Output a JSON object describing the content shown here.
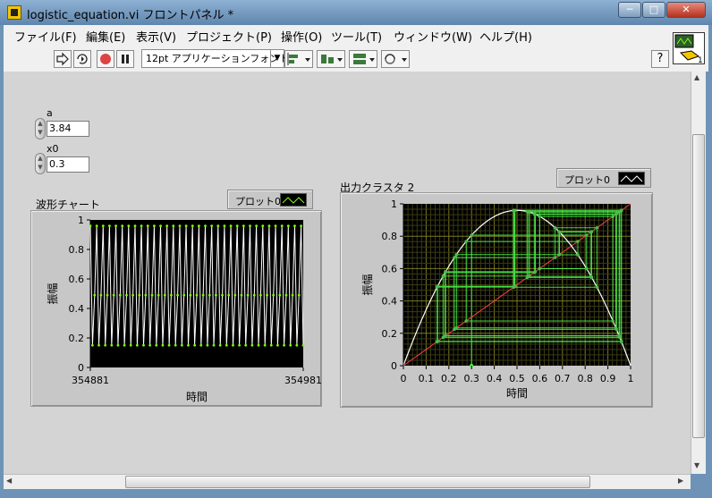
{
  "window": {
    "title": "logistic_equation.vi フロントパネル *",
    "min": "─",
    "max": "□",
    "close": "✕"
  },
  "menu": [
    "ファイル(F)",
    "編集(E)",
    "表示(V)",
    "プロジェクト(P)",
    "操作(O)",
    "ツール(T)",
    "ウィンドウ(W)",
    "ヘルプ(H)"
  ],
  "toolbar": {
    "font": "12pt アプリケーションフォント",
    "help": "?",
    "icons": [
      "run-arrow-icon",
      "run-continuous-icon",
      "abort-icon",
      "pause-icon",
      "align-icon",
      "distribute-icon",
      "resize-icon",
      "reorder-icon"
    ]
  },
  "controls": {
    "a": {
      "label": "a",
      "value": "3.84"
    },
    "x0": {
      "label": "x0",
      "value": "0.3"
    }
  },
  "chart1": {
    "title": "波形チャート",
    "legend": "プロット0",
    "xlabel": "時間",
    "ylabel": "振幅",
    "xticks": [
      "354881",
      "354981"
    ],
    "yticks": [
      "0",
      "0.2",
      "0.4",
      "0.6",
      "0.8",
      "1"
    ]
  },
  "chart2": {
    "title": "出力クラスタ 2",
    "legend": "プロット0",
    "xlabel": "時間",
    "ylabel": "振幅",
    "xticks": [
      "0",
      "0.1",
      "0.2",
      "0.3",
      "0.4",
      "0.5",
      "0.6",
      "0.7",
      "0.8",
      "0.9",
      "1"
    ],
    "yticks": [
      "0",
      "0.2",
      "0.4",
      "0.6",
      "0.8",
      "1"
    ]
  },
  "chart_data": [
    {
      "type": "line",
      "title": "波形チャート",
      "xlabel": "時間",
      "ylabel": "振幅",
      "xlim": [
        354881,
        354981
      ],
      "ylim": [
        0,
        1
      ],
      "series": [
        {
          "name": "プロット0",
          "color": "#ffffff",
          "marker_color": "#7fff00",
          "cycle_values": [
            0.96,
            0.15,
            0.49
          ]
        }
      ]
    },
    {
      "type": "line",
      "title": "出力クラスタ 2",
      "xlabel": "時間",
      "ylabel": "振幅",
      "xlim": [
        0,
        1
      ],
      "ylim": [
        0,
        1
      ],
      "a": 3.84,
      "x0": 0.3,
      "series": [
        {
          "name": "プロット0",
          "color": "#ffffff"
        },
        {
          "color": "#ff4040"
        },
        {
          "color": "#4cff4c"
        }
      ]
    }
  ]
}
